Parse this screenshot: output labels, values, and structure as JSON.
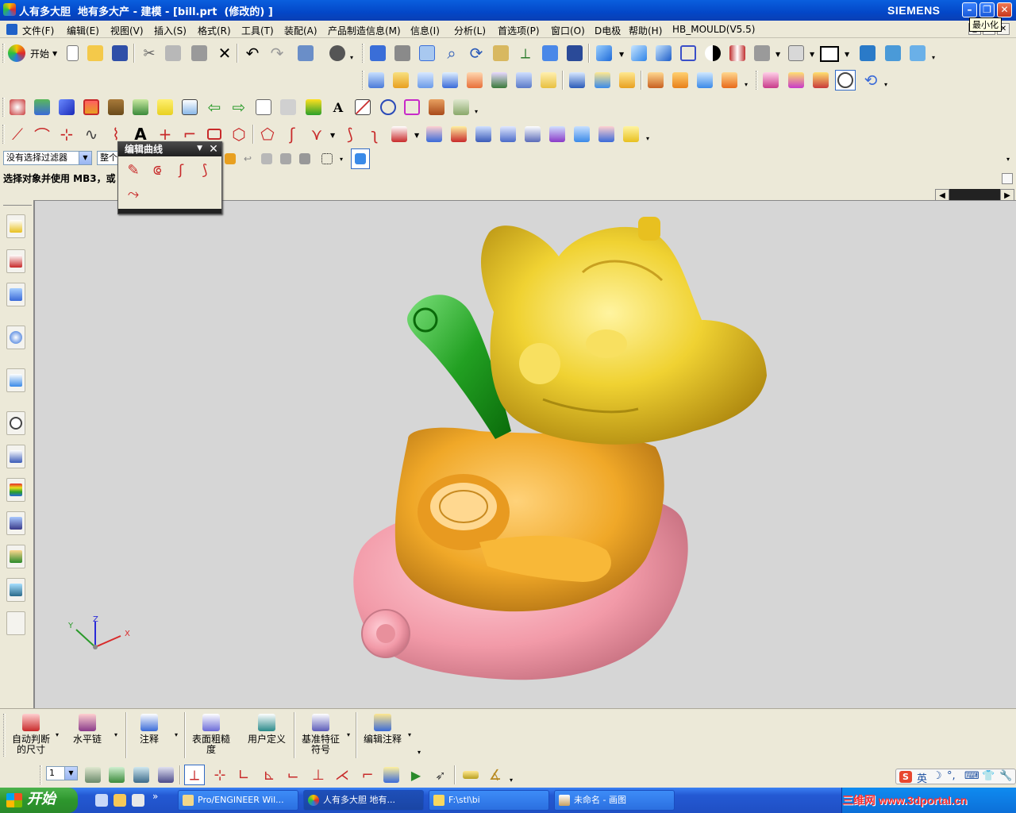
{
  "window": {
    "title": "人有多大胆  地有多大产 - 建模 - [bill.prt  (修改的) ]",
    "brand": "SIEMENS",
    "tooltip_minimize": "最小化"
  },
  "menubar": {
    "items": [
      "文件(F)",
      "编辑(E)",
      "视图(V)",
      "插入(S)",
      "格式(R)",
      "工具(T)",
      "装配(A)",
      "产品制造信息(M)",
      "信息(I)",
      "分析(L)",
      "首选项(P)",
      "窗口(O)",
      "D电极",
      "帮助(H)",
      "HB_MOULD(V5.5)"
    ]
  },
  "standard_toolbar": {
    "start_label": "开始"
  },
  "selection": {
    "filter_value": "没有选择过滤器",
    "scope_value": "整个",
    "prompt": "选择对象并使用 MB3，或"
  },
  "palette": {
    "title": "编辑曲线"
  },
  "viewport": {
    "axis_labels": {
      "x": "X",
      "y": "Y",
      "z": "Z"
    },
    "model_colors": {
      "head": "#f2d63a",
      "body": "#f2b02e",
      "base": "#f59aa8",
      "leaf": "#2aa02a"
    },
    "background": "#d6d6d6"
  },
  "pmi_toolbar": {
    "buttons": [
      {
        "label": "自动判断的尺寸",
        "line1": "自动判断",
        "line2": "的尺寸"
      },
      {
        "label": "水平链",
        "line1": "水平链",
        "line2": ""
      },
      {
        "label": "注释",
        "line1": "注释",
        "line2": ""
      },
      {
        "label": "表面粗糙度",
        "line1": "表面粗糙",
        "line2": "度"
      },
      {
        "label": "用户定义",
        "line1": "用户定义",
        "line2": ""
      },
      {
        "label": "基准特征符号",
        "line1": "基准特征",
        "line2": "符号"
      },
      {
        "label": "编辑注释",
        "line1": "编辑注释",
        "line2": ""
      }
    ]
  },
  "bottom_toolbar": {
    "layer_value": "1"
  },
  "ime": {
    "lang": "英"
  },
  "taskbar": {
    "start_label": "开始",
    "tasks": [
      "Pro/ENGINEER Wil...",
      "人有多大胆  地有...",
      "F:\\stl\\bi",
      "未命名 - 画图"
    ],
    "tray_watermark": "三维网 www.3dportal.cn"
  }
}
